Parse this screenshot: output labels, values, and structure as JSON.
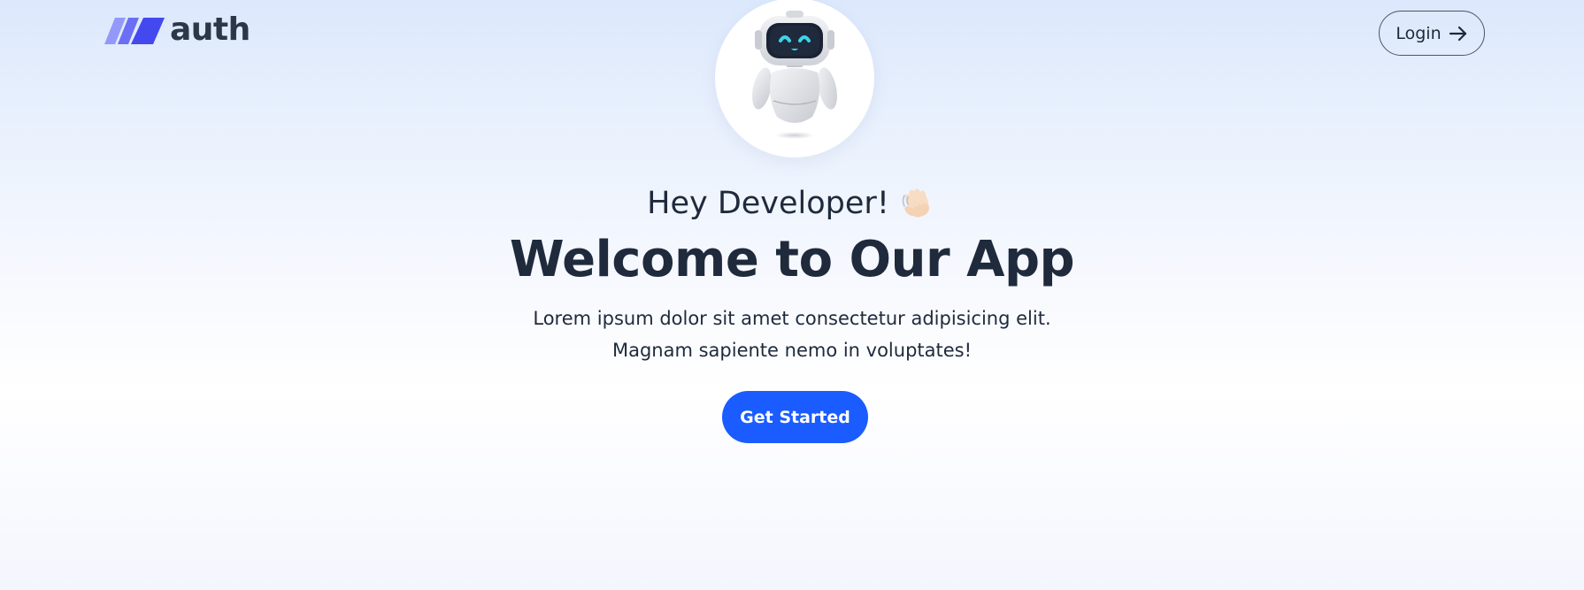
{
  "header": {
    "logo_text": "auth",
    "login_label": "Login"
  },
  "hero": {
    "greeting": "Hey Developer!",
    "title": "Welcome to Our App",
    "description": "Lorem ipsum dolor sit amet consectetur adipisicing elit. Magnam sapiente nemo in voluptates!",
    "cta_label": "Get Started"
  },
  "icons": {
    "logo": "slanted-stripes-logo-icon",
    "login": "arrow-right-icon",
    "avatar": "robot-icon",
    "greeting": "waving-hand-icon"
  },
  "colors": {
    "accent": "#1a5cff",
    "text": "#1f2a3c",
    "logo_stripes": [
      "#8b8ff9",
      "#6a6ff5",
      "#4a4ff0"
    ]
  }
}
